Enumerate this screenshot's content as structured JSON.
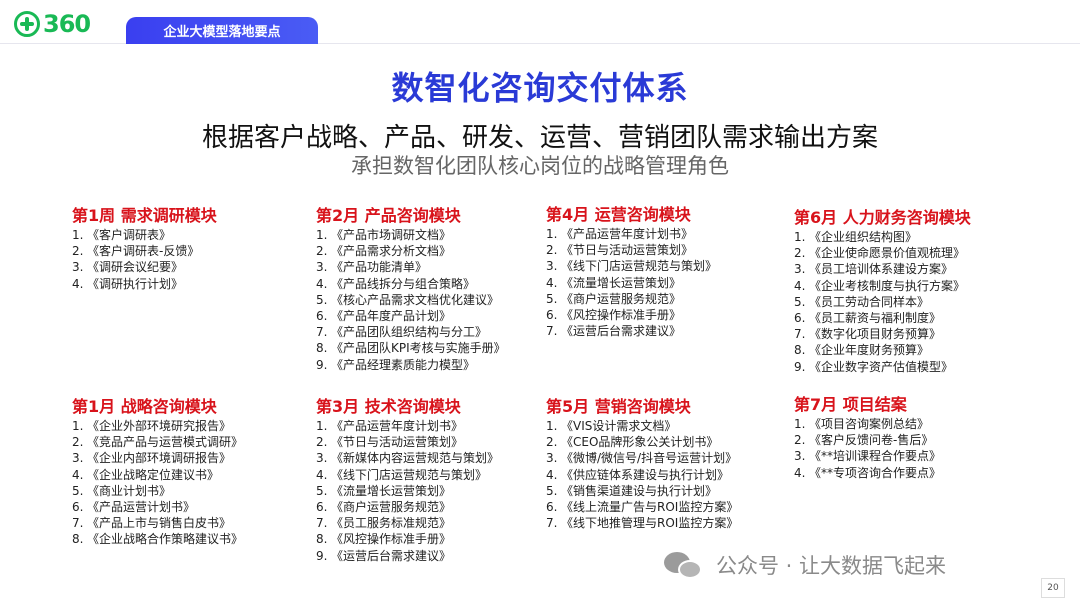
{
  "header": {
    "logo_text": "360",
    "section_tab": "企业大模型落地要点"
  },
  "title": "数智化咨询交付体系",
  "subtitle": "根据客户战略、产品、研发、运营、营销团队需求输出方案",
  "subtitle2": "承担数智化团队核心岗位的战略管理角色",
  "modules": [
    {
      "title": "第1周 需求调研模块",
      "items": [
        {
          "num": "1.",
          "text": "《客户调研表》"
        },
        {
          "num": "2.",
          "text": "《客户调研表-反馈》"
        },
        {
          "num": "3.",
          "text": "《调研会议纪要》"
        },
        {
          "num": "4.",
          "text": "《调研执行计划》"
        }
      ]
    },
    {
      "title": "第2月 产品咨询模块",
      "items": [
        {
          "num": "1.",
          "text": "《产品市场调研文档》"
        },
        {
          "num": "2.",
          "text": "《产品需求分析文档》"
        },
        {
          "num": "3.",
          "text": "《产品功能清单》"
        },
        {
          "num": "4.",
          "text": "《产品线拆分与组合策略》"
        },
        {
          "num": "5.",
          "text": "《核心产品需求文档优化建议》"
        },
        {
          "num": "6.",
          "text": "《产品年度产品计划》"
        },
        {
          "num": "7.",
          "text": "《产品团队组织结构与分工》"
        },
        {
          "num": "8.",
          "text": "《产品团队KPI考核与实施手册》"
        },
        {
          "num": "9.",
          "text": "《产品经理素质能力模型》"
        }
      ]
    },
    {
      "title": "第4月 运营咨询模块",
      "items": [
        {
          "num": "1.",
          "text": "《产品运营年度计划书》"
        },
        {
          "num": "2.",
          "text": "《节日与活动运营策划》"
        },
        {
          "num": "3.",
          "text": "《线下门店运营规范与策划》"
        },
        {
          "num": "4.",
          "text": "《流量增长运营策划》"
        },
        {
          "num": "5.",
          "text": "《商户运营服务规范》"
        },
        {
          "num": "6.",
          "text": "《风控操作标准手册》"
        },
        {
          "num": "7.",
          "text": "《运营后台需求建议》"
        }
      ]
    },
    {
      "title": "第6月 人力财务咨询模块",
      "items": [
        {
          "num": "1.",
          "text": "《企业组织结构图》"
        },
        {
          "num": "2.",
          "text": "《企业使命愿景价值观梳理》"
        },
        {
          "num": "3.",
          "text": "《员工培训体系建设方案》"
        },
        {
          "num": "4.",
          "text": "《企业考核制度与执行方案》"
        },
        {
          "num": "5.",
          "text": "《员工劳动合同样本》"
        },
        {
          "num": "6.",
          "text": "《员工薪资与福利制度》"
        },
        {
          "num": "7.",
          "text": "《数字化项目财务预算》"
        },
        {
          "num": "8.",
          "text": "《企业年度财务预算》"
        },
        {
          "num": "9.",
          "text": "《企业数字资产估值模型》"
        }
      ]
    },
    {
      "title": "第1月 战略咨询模块",
      "items": [
        {
          "num": "1.",
          "text": "《企业外部环境研究报告》"
        },
        {
          "num": "2.",
          "text": "《竞品产品与运营模式调研》"
        },
        {
          "num": "3.",
          "text": "《企业内部环境调研报告》"
        },
        {
          "num": "4.",
          "text": "《企业战略定位建议书》"
        },
        {
          "num": "5.",
          "text": "《商业计划书》"
        },
        {
          "num": "6.",
          "text": "《产品运营计划书》"
        },
        {
          "num": "7.",
          "text": "《产品上市与销售白皮书》"
        },
        {
          "num": "8.",
          "text": "《企业战略合作策略建议书》"
        }
      ]
    },
    {
      "title": "第3月 技术咨询模块",
      "items": [
        {
          "num": "1.",
          "text": "《产品运营年度计划书》"
        },
        {
          "num": "2.",
          "text": "《节日与活动运营策划》"
        },
        {
          "num": "3.",
          "text": "《新媒体内容运营规范与策划》"
        },
        {
          "num": "4.",
          "text": "《线下门店运营规范与策划》"
        },
        {
          "num": "5.",
          "text": "《流量增长运营策划》"
        },
        {
          "num": "6.",
          "text": "《商户运营服务规范》"
        },
        {
          "num": "7.",
          "text": "《员工服务标准规范》"
        },
        {
          "num": "8.",
          "text": "《风控操作标准手册》"
        },
        {
          "num": "9.",
          "text": "《运营后台需求建议》"
        }
      ]
    },
    {
      "title": "第5月 营销咨询模块",
      "items": [
        {
          "num": "1.",
          "text": "《VIS设计需求文档》"
        },
        {
          "num": "2.",
          "text": "《CEO品牌形象公关计划书》"
        },
        {
          "num": "3.",
          "text": "《微博/微信号/抖音号运营计划》"
        },
        {
          "num": "4.",
          "text": "《供应链体系建设与执行计划》"
        },
        {
          "num": "5.",
          "text": "《销售渠道建设与执行计划》"
        },
        {
          "num": "6.",
          "text": "《线上流量广告与ROI监控方案》"
        },
        {
          "num": "7.",
          "text": "《线下地推管理与ROI监控方案》"
        }
      ]
    },
    {
      "title": "第7月 项目结案",
      "items": [
        {
          "num": "1.",
          "text": "《项目咨询案例总结》"
        },
        {
          "num": "2.",
          "text": "《客户反馈问卷-售后》"
        },
        {
          "num": "3.",
          "text": "《**培训课程合作要点》"
        },
        {
          "num": "4.",
          "text": "《**专项咨询合作要点》"
        }
      ]
    }
  ],
  "watermark": "公众号 · 让大数据飞起来",
  "page_number": "20"
}
